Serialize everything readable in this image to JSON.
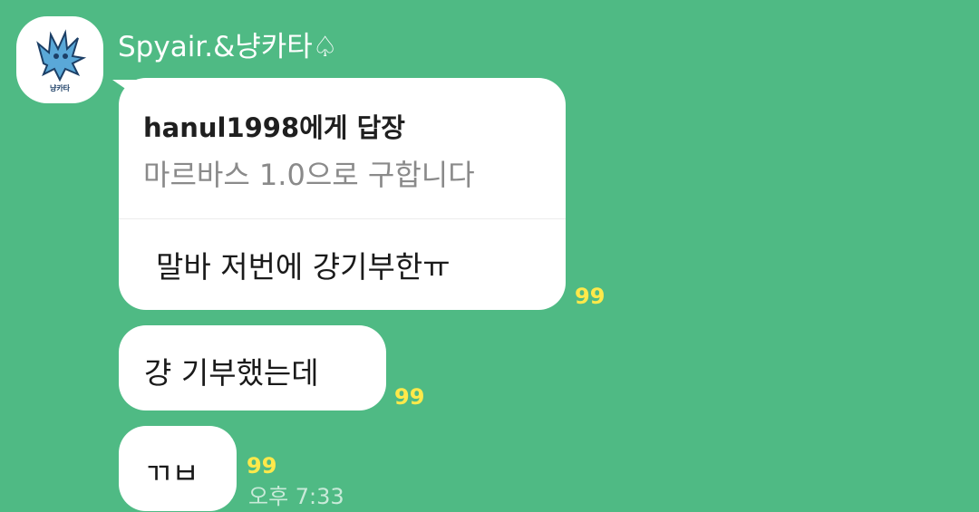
{
  "sender": {
    "name": "Spyair.&냥카타♤",
    "avatar_icon": "dragon-avatar-icon",
    "avatar_caption": "냥카타"
  },
  "messages": [
    {
      "type": "reply",
      "reply_to": "hanul1998에게 답장",
      "quoted_text": "마르바스 1.0으로 구합니다",
      "text": "말바 저번에 걍기부한ㅠ",
      "unread": "99"
    },
    {
      "type": "text",
      "text": "걍 기부했는데",
      "unread": "99"
    },
    {
      "type": "text",
      "text": "ㄲㅂ",
      "unread": "99",
      "time": "오후 7:33"
    }
  ],
  "colors": {
    "background": "#4fba84",
    "bubble": "#ffffff",
    "unread": "#ffe94a"
  }
}
